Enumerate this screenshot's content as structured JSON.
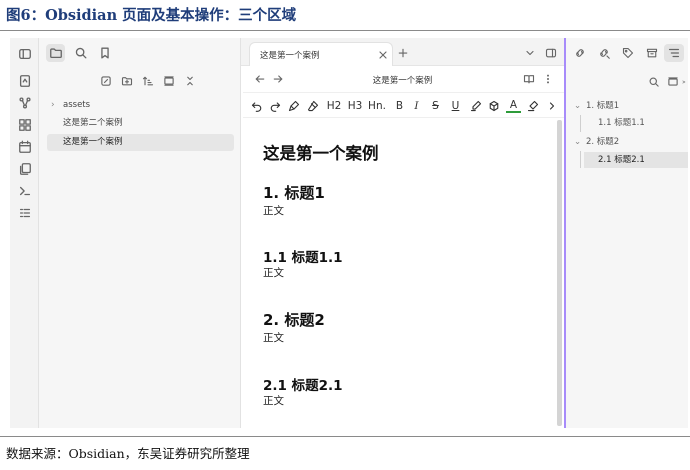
{
  "figure": {
    "title": "图6：Obsidian 页面及基本操作：三个区域",
    "source": "数据来源：Obsidian，东吴证券研究所整理"
  },
  "left_sidebar": {
    "tree": [
      {
        "label": "assets",
        "type": "folder",
        "selected": false
      },
      {
        "label": "这是第二个案例",
        "type": "file",
        "selected": false
      },
      {
        "label": "这是第一个案例",
        "type": "file",
        "selected": true
      }
    ]
  },
  "editor": {
    "tab_label": "这是第一个案例",
    "nav_title": "这是第一个案例",
    "toolbar": {
      "h2": "H2",
      "h3": "H3",
      "hn": "Hn.",
      "bold": "B",
      "italic": "I",
      "strike": "S",
      "underline": "U",
      "text_color": "A"
    },
    "document": {
      "title": "这是第一个案例",
      "sections": [
        {
          "heading": "1. 标题1",
          "level": 2,
          "body": "正文"
        },
        {
          "heading": "1.1 标题1.1",
          "level": 3,
          "body": "正文"
        },
        {
          "heading": "2. 标题2",
          "level": 2,
          "body": "正文"
        },
        {
          "heading": "2.1 标题2.1",
          "level": 3,
          "body": "正文"
        }
      ]
    }
  },
  "outline": {
    "items": [
      {
        "label": "1. 标题1",
        "depth": 0,
        "selected": false
      },
      {
        "label": "1.1 标题1.1",
        "depth": 1,
        "selected": false
      },
      {
        "label": "2. 标题2",
        "depth": 0,
        "selected": false
      },
      {
        "label": "2.1 标题2.1",
        "depth": 1,
        "selected": true
      }
    ]
  },
  "colors": {
    "accent": "#a78bfa",
    "title_blue": "#1f3d7a",
    "text_color_underline": "#2e9c3a"
  }
}
